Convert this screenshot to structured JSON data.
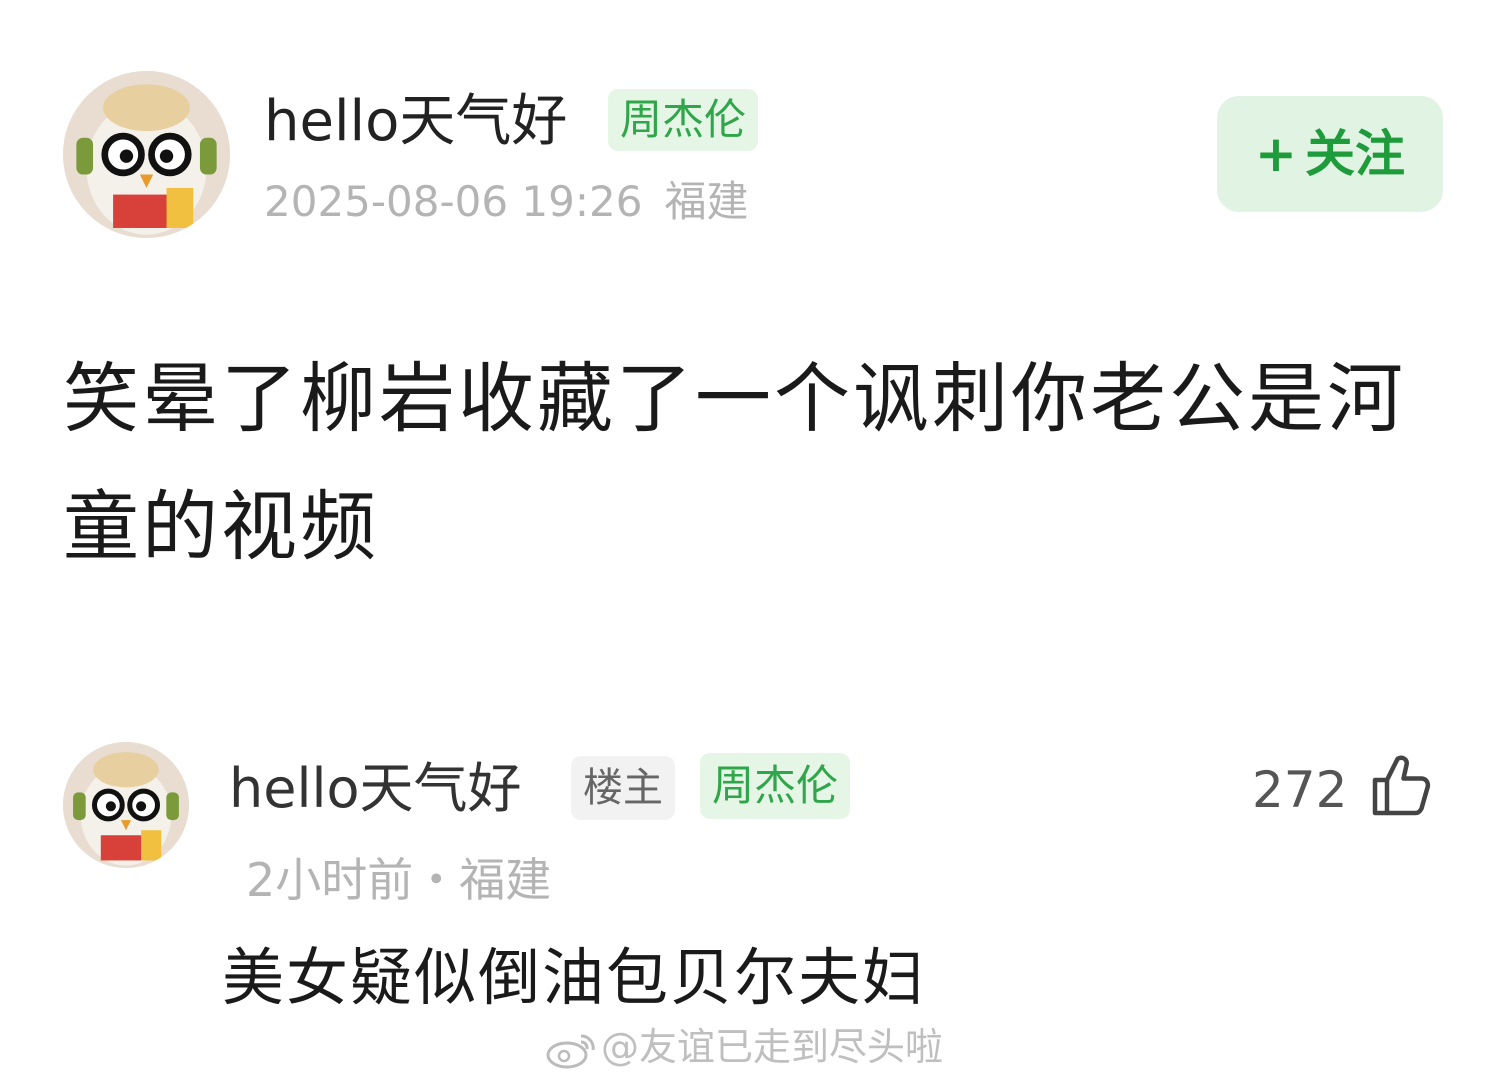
{
  "post": {
    "username": "hello天气好",
    "badge": "周杰伦",
    "datetime": "2025-08-06 19:26",
    "location": "福建",
    "follow_label": "关注",
    "follow_plus": "+",
    "content": "笑晕了柳岩收藏了一个讽刺你老公是河童的视频"
  },
  "comment": {
    "username": "hello天气好",
    "host_badge": "楼主",
    "badge": "周杰伦",
    "meta": "2小时前・福建",
    "likes": "272",
    "text": "美女疑似倒油包贝尔夫妇"
  },
  "watermark": {
    "text": "@友谊已走到尽头啦",
    "icon": "weibo-icon"
  },
  "colors": {
    "accent_green": "#2fa64a",
    "follow_bg": "#e1f3e3",
    "meta_grey": "#b4b4b4"
  }
}
